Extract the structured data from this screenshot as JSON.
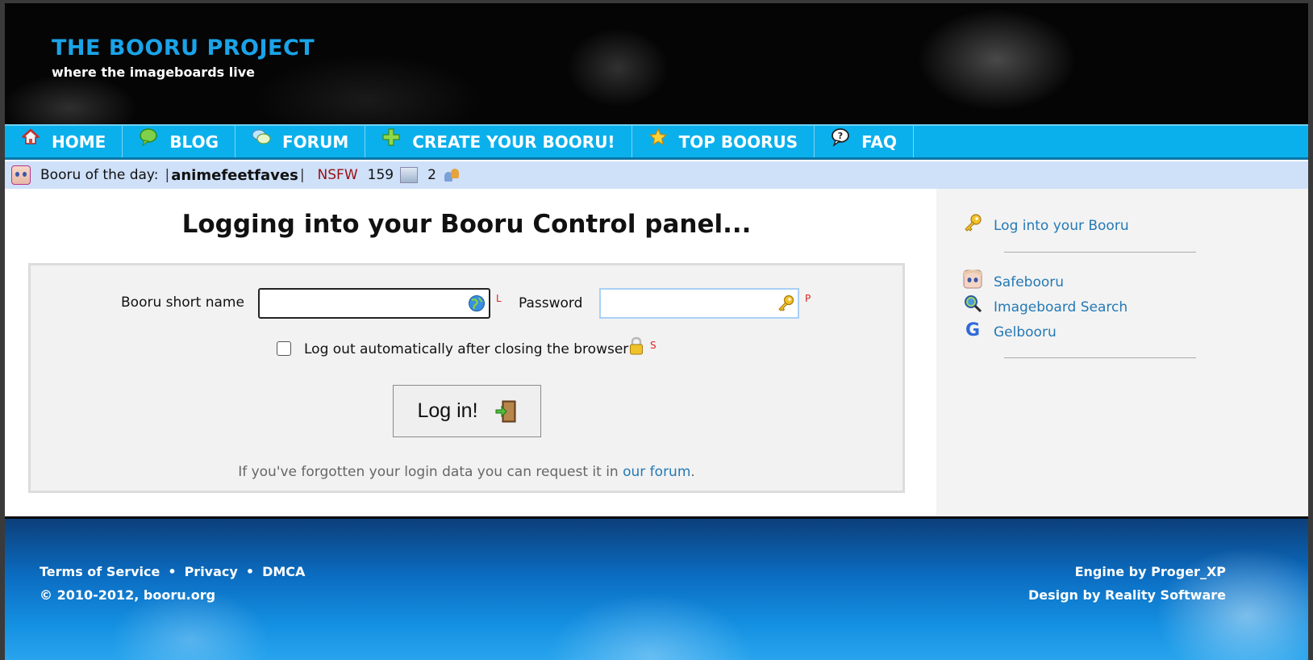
{
  "header": {
    "title": "THE BOORU PROJECT",
    "tagline": "where the imageboards live"
  },
  "nav": {
    "items": [
      {
        "label": "HOME",
        "icon": "home-icon"
      },
      {
        "label": "BLOG",
        "icon": "speech-bubble-icon"
      },
      {
        "label": "FORUM",
        "icon": "chat-bubbles-icon"
      },
      {
        "label": "CREATE YOUR BOORU!",
        "icon": "plus-icon"
      },
      {
        "label": "TOP BOORUS",
        "icon": "star-icon"
      },
      {
        "label": "FAQ",
        "icon": "question-bubble-icon"
      }
    ]
  },
  "booru_of_day": {
    "prefix": "Booru of the day:",
    "name": "animefeetfaves",
    "rating": "NSFW",
    "images_count": "159",
    "users_count": "2"
  },
  "main": {
    "title": "Logging into your Booru Control panel...",
    "short_name_label": "Booru short name",
    "short_name_value": "",
    "short_name_hotkey": "L",
    "password_label": "Password",
    "password_value": "",
    "password_hotkey": "P",
    "autologout_label": "Log out automatically after closing the browser",
    "autologout_hotkey": "S",
    "autologout_checked": false,
    "login_button": "Log in!",
    "forgot_text": "If you've forgotten your login data you can request it in",
    "forgot_link": "our forum",
    "forgot_end": "."
  },
  "sidebar": {
    "login_link": "Log into your Booru",
    "links": [
      "Safebooru",
      "Imageboard Search",
      "Gelbooru"
    ]
  },
  "footer": {
    "terms": "Terms of Service",
    "privacy": "Privacy",
    "dmca": "DMCA",
    "copyright": "© 2010-2012, booru.org",
    "engine": "Engine by Proger_XP",
    "design": "Design by Reality Software"
  },
  "colors": {
    "accent": "#0ab0ec",
    "title": "#1aa3e8",
    "link": "#2479b5",
    "nsfw": "#9a1010",
    "hotkey": "#dd2222"
  }
}
